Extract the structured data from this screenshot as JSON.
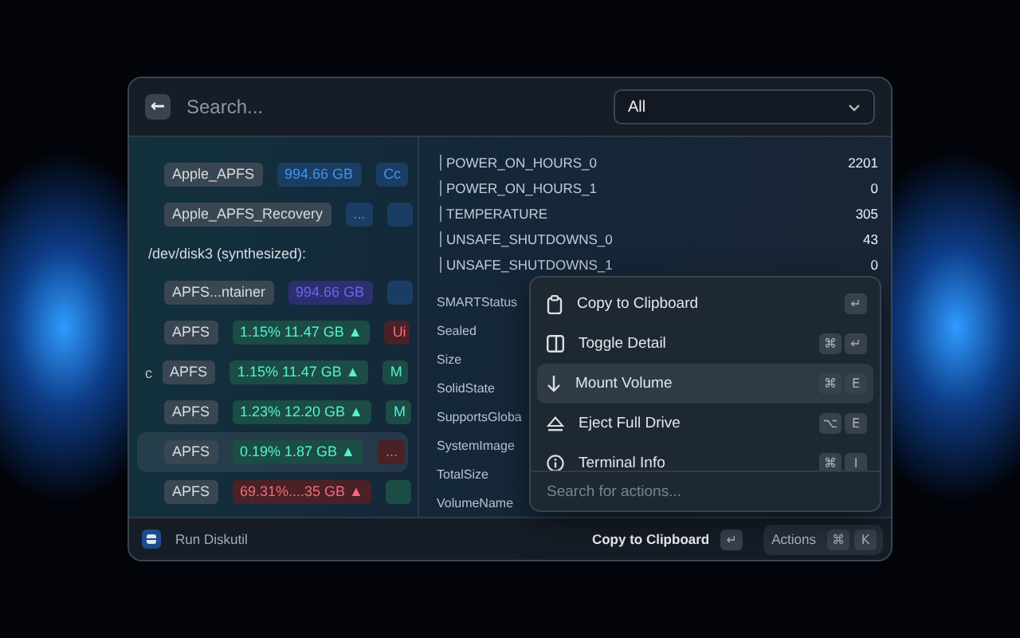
{
  "search": {
    "placeholder": "Search...",
    "back_icon": "←"
  },
  "filter": {
    "value": "All"
  },
  "sections": [
    {
      "rows": [
        {
          "name": "Apple_APFS",
          "size": {
            "text": "994.66 GB",
            "color": "#1a3d63"
          },
          "extra": {
            "text": "Cc",
            "color": "#1a3d63"
          },
          "selected": false
        },
        {
          "name": "Apple_APFS_Recovery",
          "size": {
            "text": "...",
            "color": "#1a3d63"
          },
          "extra": {
            "color": "#1a3d63"
          },
          "selected": false
        }
      ]
    },
    {
      "header": "/dev/disk3 (synthesized):",
      "rows": [
        {
          "name": "APFS...ntainer",
          "size": {
            "text": "994.66 GB",
            "color": "#2e2f6e"
          },
          "extra": {
            "color": "#1a3d63"
          },
          "selected": false
        },
        {
          "name": "APFS",
          "size": {
            "text": "1.15% 11.47 GB ▲",
            "color": "#1b4d44"
          },
          "extra": {
            "text": "Ui",
            "color": "#4a2126"
          },
          "selected": false
        },
        {
          "prefix": "c",
          "name": "APFS",
          "size": {
            "text": "1.15% 11.47 GB ▲",
            "color": "#1b4d44"
          },
          "extra": {
            "text": "M",
            "color": "#1b4d44"
          },
          "selected": false
        },
        {
          "name": "APFS",
          "size": {
            "text": "1.23% 12.20 GB ▲",
            "color": "#1b4d44"
          },
          "extra": {
            "text": "M",
            "color": "#1b4d44"
          },
          "selected": false
        },
        {
          "name": "APFS",
          "size": {
            "text": "0.19% 1.87 GB ▲",
            "color": "#1b4d44"
          },
          "extra": {
            "text": "...",
            "color": "#4a2126"
          },
          "selected": true
        },
        {
          "name": "APFS",
          "size": {
            "text": "69.31%....35 GB ▲",
            "color": "#4a2126"
          },
          "extra": {
            "color": "#1b4d44"
          },
          "selected": false
        }
      ]
    }
  ],
  "metrics": [
    {
      "label": "POWER_ON_HOURS_0",
      "value": "2201"
    },
    {
      "label": "POWER_ON_HOURS_1",
      "value": "0"
    },
    {
      "label": "TEMPERATURE",
      "value": "305"
    },
    {
      "label": "UNSAFE_SHUTDOWNS_0",
      "value": "43"
    },
    {
      "label": "UNSAFE_SHUTDOWNS_1",
      "value": "0"
    }
  ],
  "properties": [
    "SMARTStatus",
    "Sealed",
    "Size",
    "SolidState",
    "SupportsGloba",
    "SystemImage",
    "TotalSize",
    "VolumeName"
  ],
  "actions_menu": {
    "items": [
      {
        "kind": "clipboard",
        "label": "Copy to Clipboard",
        "keys": [
          "↵"
        ],
        "selected": false
      },
      {
        "kind": "panel",
        "label": "Toggle Detail",
        "keys": [
          "⌘",
          "↵"
        ],
        "selected": false
      },
      {
        "kind": "arrow",
        "label": "Mount Volume",
        "keys": [
          "⌘",
          "E"
        ],
        "selected": true
      },
      {
        "kind": "eject",
        "label": "Eject Full Drive",
        "keys": [
          "⌥",
          "E"
        ],
        "selected": false
      },
      {
        "kind": "info",
        "label": "Terminal Info",
        "keys": [
          "⌘",
          "I"
        ],
        "selected": false
      }
    ],
    "search_placeholder": "Search for actions..."
  },
  "footer": {
    "title": "Run Diskutil",
    "primary_action": "Copy to Clipboard",
    "primary_keys": [
      "↵"
    ],
    "actions_label": "Actions",
    "actions_keys": [
      "⌘",
      "K"
    ]
  }
}
